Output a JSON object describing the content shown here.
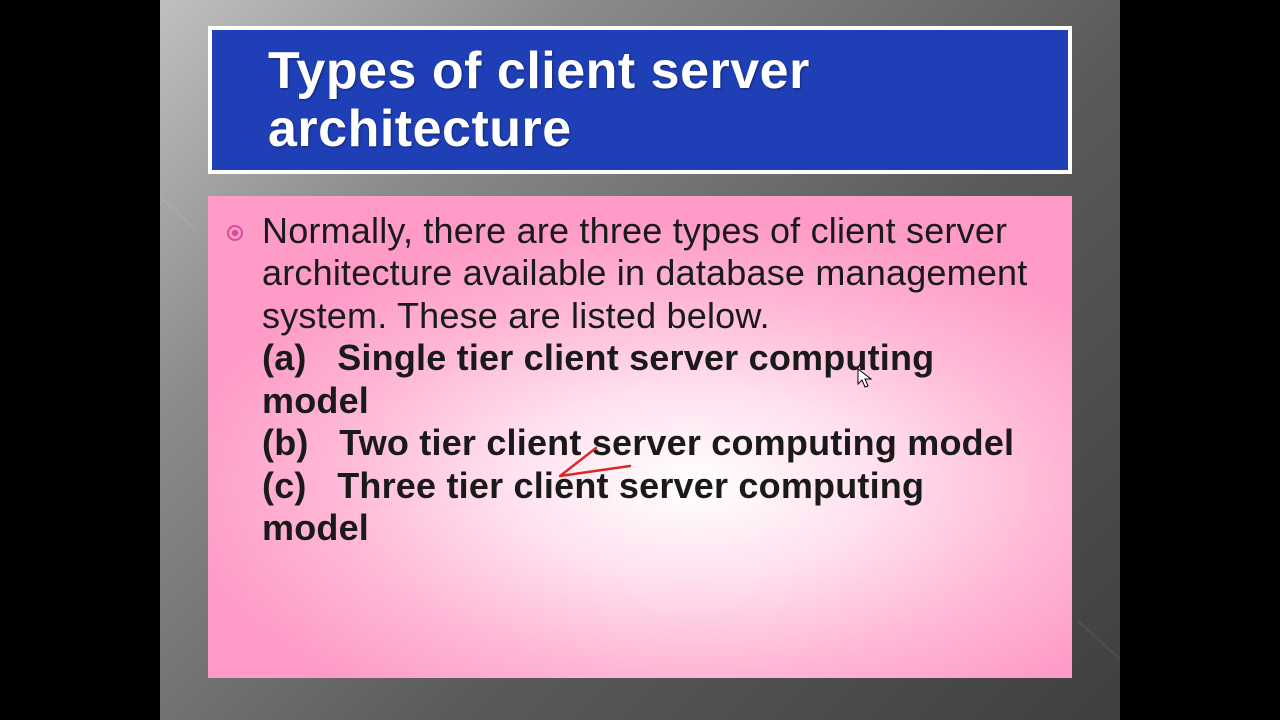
{
  "slide": {
    "title": "Types of client server architecture",
    "intro": "Normally, there are three types of client server architecture available in database management system. These are listed below.",
    "items": [
      {
        "label": "(a)",
        "text": "Single tier client server computing model"
      },
      {
        "label": "(b)",
        "text": "Two tier client server computing model"
      },
      {
        "label": "(c)",
        "text": "Three tier client server computing model"
      }
    ],
    "bullet_color": "#d84d9b"
  }
}
